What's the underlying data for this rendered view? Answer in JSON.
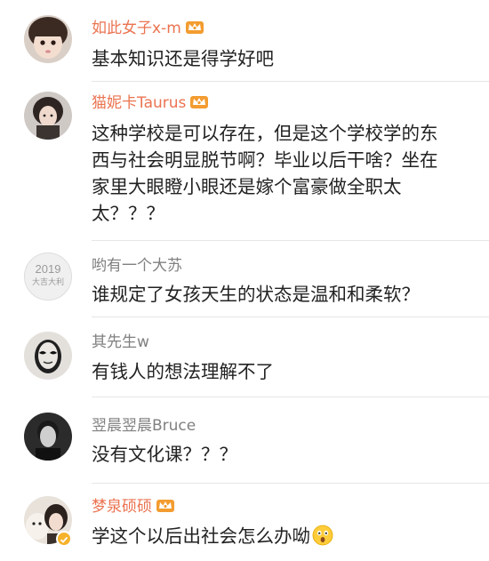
{
  "colors": {
    "vip_name": "#eb7350",
    "normal_name": "#808080",
    "text": "#222222",
    "divider": "#e6e6e6",
    "crown_badge": "#f39c30",
    "verified_badge": "#f6b22b"
  },
  "comments": [
    {
      "username": "如此女子x-m",
      "vip": true,
      "text": "基本知识还是得学好吧"
    },
    {
      "username": "猫妮卡Taurus",
      "vip": true,
      "text_lines": [
        "这种学校是可以存在，但是这个学校学的东",
        "西与社会明显脱节啊？毕业以后干啥？坐在",
        "家里大眼瞪小眼还是嫁个富豪做全职太",
        "太？？？"
      ]
    },
    {
      "username": "哟有一个大苏",
      "vip": false,
      "avatar_text": {
        "line1": "2019",
        "line2": "大吉大利"
      },
      "text": "谁规定了女孩天生的状态是温和和柔软？"
    },
    {
      "username": "其先生w",
      "vip": false,
      "text": "有钱人的想法理解不了"
    },
    {
      "username": "翌晨翌晨Bruce",
      "vip": false,
      "text": "没有文化课？？？"
    },
    {
      "username": "梦泉硕硕",
      "vip": true,
      "verified": true,
      "text": "学这个以后出社会怎么办呦",
      "emoji": "surprised-face-icon"
    }
  ]
}
